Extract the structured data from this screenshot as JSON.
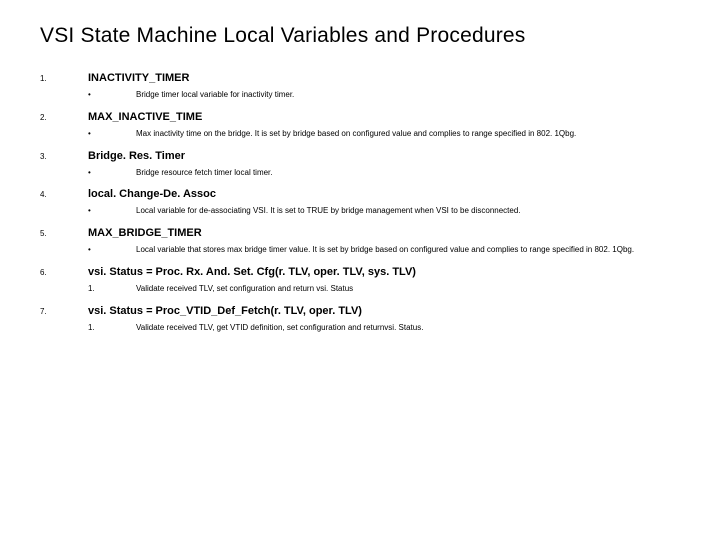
{
  "title": "VSI State Machine Local Variables and Procedures",
  "items": [
    {
      "num": "1.",
      "term": "INACTIVITY_TIMER",
      "subs": [
        {
          "marker": "•",
          "desc": "Bridge timer local variable for inactivity timer."
        }
      ]
    },
    {
      "num": "2.",
      "term": "MAX_INACTIVE_TIME",
      "subs": [
        {
          "marker": "•",
          "desc": "Max inactivity time on the bridge. It is set by bridge based on configured value and complies to range specified in 802. 1Qbg."
        }
      ]
    },
    {
      "num": "3.",
      "term": "Bridge. Res. Timer",
      "subs": [
        {
          "marker": "•",
          "desc": "Bridge resource fetch timer local timer."
        }
      ]
    },
    {
      "num": "4.",
      "term": "local. Change-De. Assoc",
      "subs": [
        {
          "marker": "•",
          "desc": "Local variable for de-associating VSI. It is set to TRUE by bridge management when VSI to be disconnected."
        }
      ]
    },
    {
      "num": "5.",
      "term": "MAX_BRIDGE_TIMER",
      "subs": [
        {
          "marker": "•",
          "desc": "Local variable that stores max bridge timer value. It is set by bridge based on configured value and complies to range specified in 802. 1Qbg."
        }
      ]
    },
    {
      "num": "6.",
      "term": "vsi. Status = Proc. Rx. And. Set. Cfg(r. TLV, oper. TLV, sys. TLV)",
      "subs": [
        {
          "marker": "1.",
          "desc": "Validate received TLV, set configuration and return vsi. Status"
        }
      ]
    },
    {
      "num": "7.",
      "term": "vsi. Status = Proc_VTID_Def_Fetch(r. TLV, oper. TLV)",
      "subs": [
        {
          "marker": "1.",
          "desc": "Validate received TLV, get VTID definition, set configuration and returnvsi. Status."
        }
      ]
    }
  ]
}
